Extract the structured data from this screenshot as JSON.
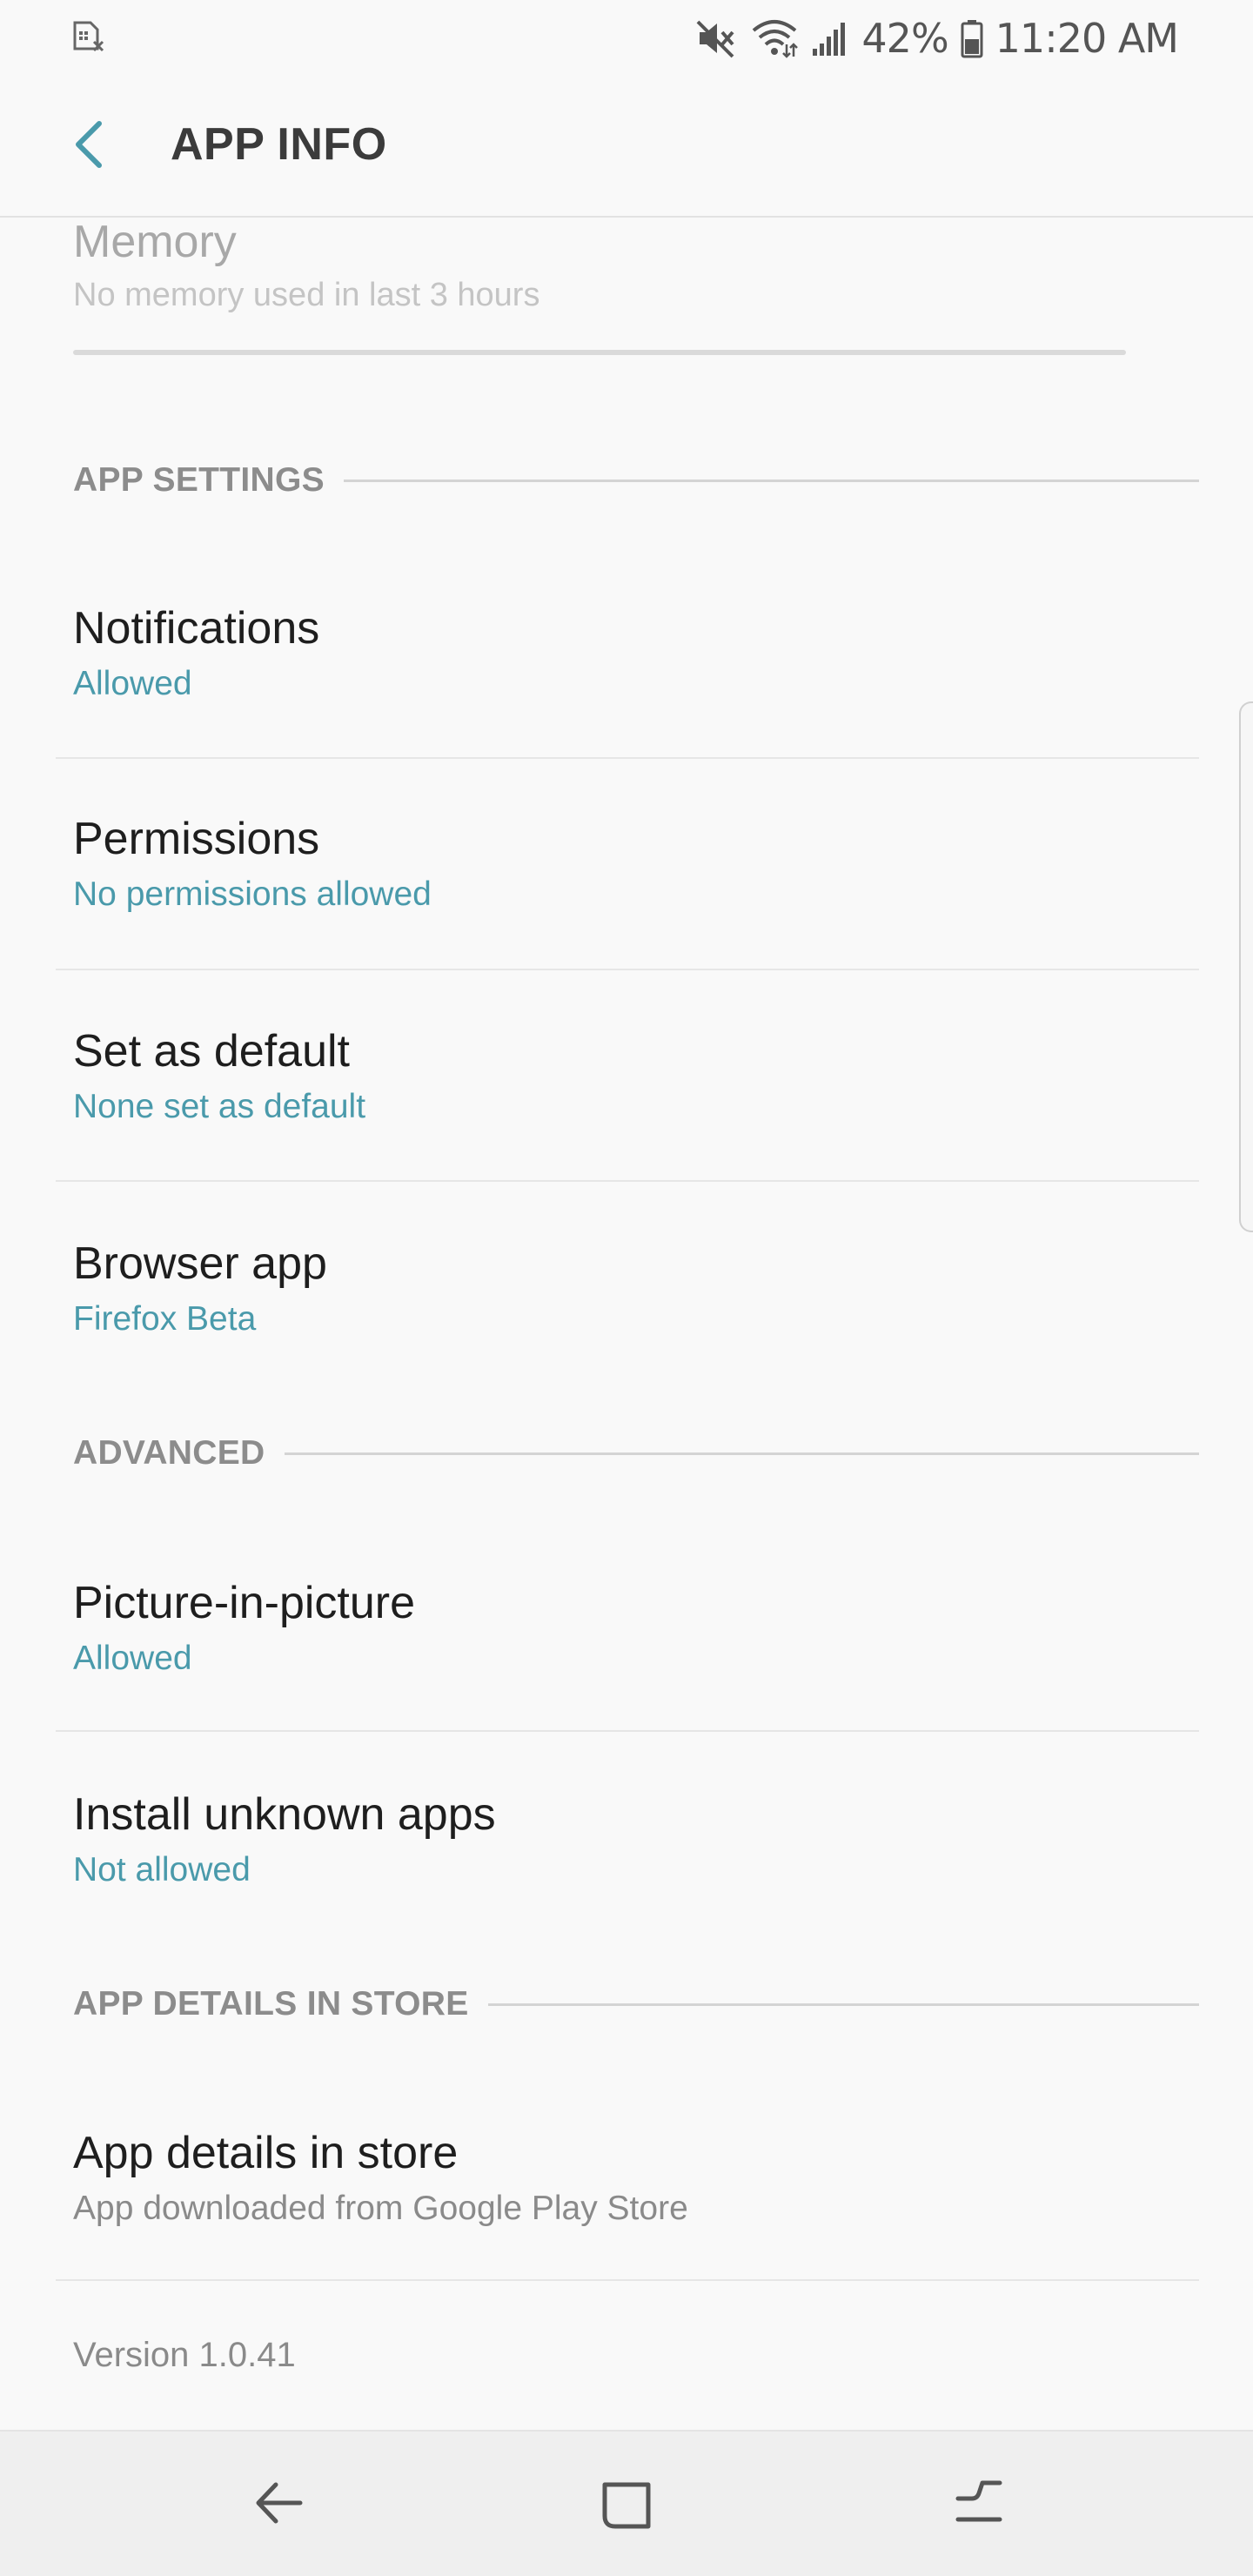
{
  "status_bar": {
    "left_icon": "sim-card-x-icon",
    "battery_percent": "42%",
    "time": "11:20 AM",
    "icons": [
      "mute-icon",
      "wifi-icon",
      "signal-icon",
      "battery-icon"
    ]
  },
  "app_bar": {
    "back_icon": "chevron-left-icon",
    "title": "APP INFO"
  },
  "memory": {
    "title": "Memory",
    "subtitle": "No memory used in last 3 hours"
  },
  "sections": {
    "app_settings": "APP SETTINGS",
    "advanced": "ADVANCED",
    "app_details_in_store": "APP DETAILS IN STORE"
  },
  "items": {
    "notifications": {
      "title": "Notifications",
      "subtitle": "Allowed"
    },
    "permissions": {
      "title": "Permissions",
      "subtitle": "No permissions allowed"
    },
    "set_as_default": {
      "title": "Set as default",
      "subtitle": "None set as default"
    },
    "browser_app": {
      "title": "Browser app",
      "subtitle": "Firefox Beta"
    },
    "picture_in_picture": {
      "title": "Picture-in-picture",
      "subtitle": "Allowed"
    },
    "install_unknown_apps": {
      "title": "Install unknown apps",
      "subtitle": "Not allowed"
    },
    "app_details_in_store": {
      "title": "App details in store",
      "subtitle": "App downloaded from Google Play Store"
    }
  },
  "version": "Version 1.0.41",
  "colors": {
    "accent": "#4a9aab",
    "background": "#f9f9f9",
    "title_text": "#1e1e1e",
    "section_label": "#8c8c8c"
  },
  "nav_bar": {
    "icons": [
      "back-arrow-icon",
      "home-square-icon",
      "recents-icon"
    ]
  }
}
